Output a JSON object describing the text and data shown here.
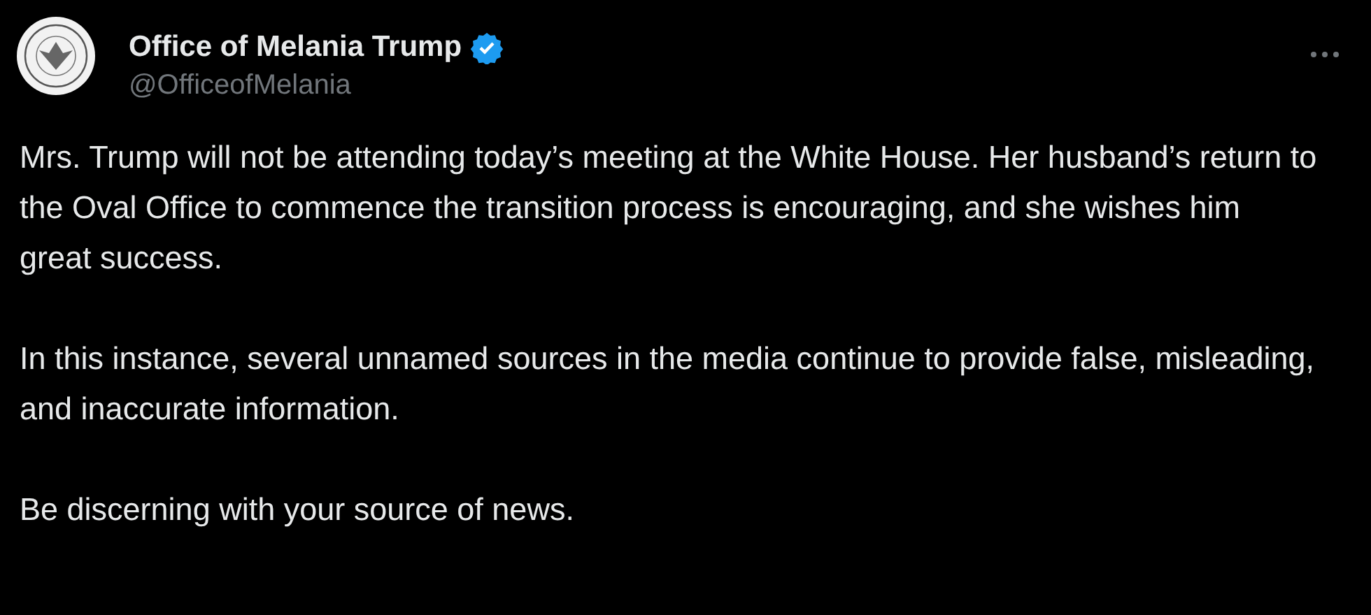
{
  "post": {
    "author": {
      "name": "Office of Melania Trump",
      "handle": "@OfficeofMelania",
      "verified": true
    },
    "paragraphs": [
      "Mrs. Trump will not be attending today’s meeting at the White House. Her husband’s return to the Oval Office to commence the transition process is encouraging, and she wishes him great success.",
      "In this instance, several unnamed sources in the media continue to provide false, misleading, and inaccurate information.",
      "Be discerning with your source of news."
    ]
  }
}
